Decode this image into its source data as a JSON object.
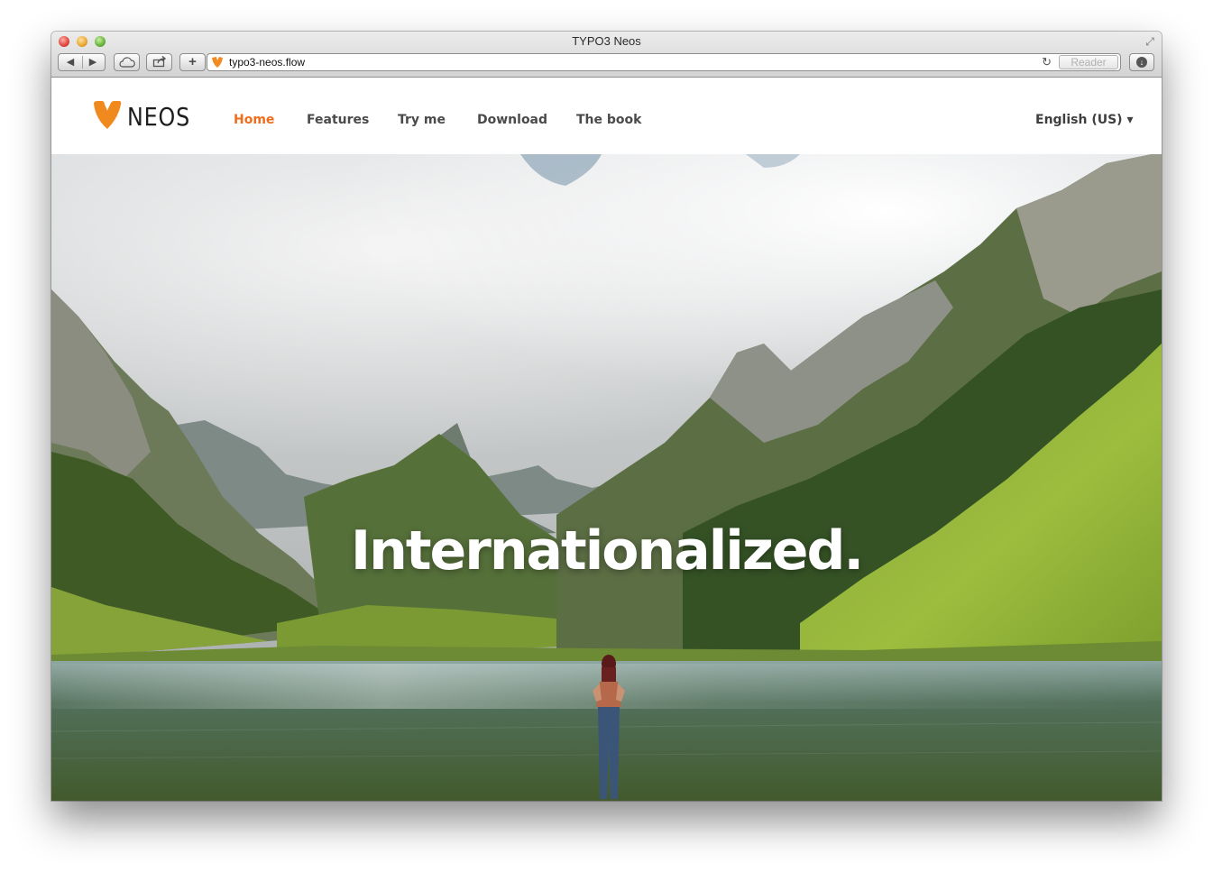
{
  "browser": {
    "window_title": "TYPO3 Neos",
    "url": "typo3-neos.flow",
    "reader_label": "Reader",
    "back_glyph": "◀",
    "forward_glyph": "▶",
    "new_tab_glyph": "+",
    "reload_glyph": "↻",
    "fullscreen_glyph": "⤢",
    "download_glyph": "↓"
  },
  "site": {
    "logo_text": "NEOS",
    "brand_color": "#ef6e1e",
    "nav": [
      {
        "label": "Home",
        "active": true
      },
      {
        "label": "Features",
        "active": false
      },
      {
        "label": "Try me",
        "active": false
      },
      {
        "label": "Download",
        "active": false
      },
      {
        "label": "The book",
        "active": false
      }
    ],
    "language_selector": "English (US) ▾",
    "hero_title": "Internationalized."
  }
}
